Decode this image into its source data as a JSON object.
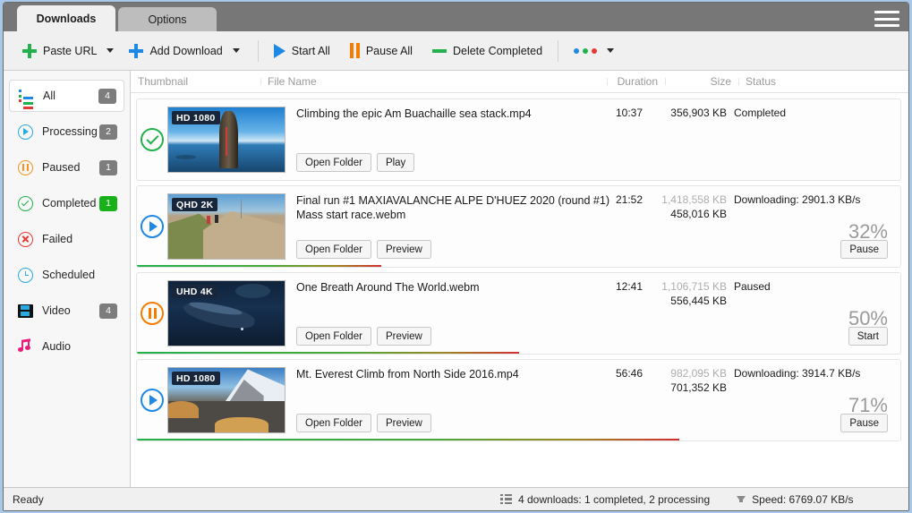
{
  "tabs": [
    {
      "label": "Downloads",
      "active": true
    },
    {
      "label": "Options",
      "active": false
    }
  ],
  "menu_icon": "hamburger-icon",
  "toolbar": {
    "paste_url": "Paste URL",
    "add_download": "Add Download",
    "start_all": "Start All",
    "pause_all": "Pause All",
    "delete_completed": "Delete Completed",
    "more_dots_colors": [
      "#1e88e5",
      "#22b14c",
      "#e53935"
    ]
  },
  "sidebar": {
    "items": [
      {
        "label": "All",
        "icon": "list-icon",
        "count": "4",
        "active": true,
        "badge_color": "#7d7d7d"
      },
      {
        "label": "Processing",
        "icon": "play-circle-icon",
        "count": "2",
        "active": false,
        "badge_color": "#7d7d7d"
      },
      {
        "label": "Paused",
        "icon": "pause-circle-icon",
        "count": "1",
        "active": false,
        "badge_color": "#7d7d7d"
      },
      {
        "label": "Completed",
        "icon": "check-circle-icon",
        "count": "1",
        "active": false,
        "badge_color": "#19b119"
      },
      {
        "label": "Failed",
        "icon": "error-circle-icon",
        "count": "",
        "active": false,
        "badge_color": ""
      },
      {
        "label": "Scheduled",
        "icon": "clock-icon",
        "count": "",
        "active": false,
        "badge_color": ""
      },
      {
        "label": "Video",
        "icon": "film-icon",
        "count": "4",
        "active": false,
        "badge_color": "#7d7d7d"
      },
      {
        "label": "Audio",
        "icon": "music-note-icon",
        "count": "",
        "active": false,
        "badge_color": ""
      }
    ]
  },
  "table": {
    "headers": {
      "thumbnail": "Thumbnail",
      "file_name": "File Name",
      "duration": "Duration",
      "size": "Size",
      "status": "Status"
    },
    "rows": [
      {
        "state_icon": "check-circle-icon",
        "state_color": "#22b14c",
        "quality_tag": "HD 1080",
        "file_name": "Climbing the epic Am Buachaille sea stack.mp4",
        "duration": "10:37",
        "size_total": "",
        "size_done": "356,903 KB",
        "status": "Completed",
        "percent": "",
        "progress": 100,
        "buttons": [
          "Open Folder",
          "Play"
        ],
        "action_button": "",
        "show_progress_bar": false
      },
      {
        "state_icon": "play-circle-icon",
        "state_color": "#1e88e5",
        "quality_tag": "QHD 2K",
        "file_name": "Final run #1  MAXIAVALANCHE ALPE D'HUEZ 2020 (round #1) Mass start race.webm",
        "duration": "21:52",
        "size_total": "1,418,558 KB",
        "size_done": "458,016 KB",
        "status": "Downloading: 2901.3 KB/s",
        "percent": "32%",
        "progress": 32,
        "buttons": [
          "Open Folder",
          "Preview"
        ],
        "action_button": "Pause",
        "show_progress_bar": true
      },
      {
        "state_icon": "pause-circle-icon",
        "state_color": "#f57c00",
        "quality_tag": "UHD 4K",
        "file_name": "One Breath Around The World.webm",
        "duration": "12:41",
        "size_total": "1,106,715 KB",
        "size_done": "556,445 KB",
        "status": "Paused",
        "percent": "50%",
        "progress": 50,
        "buttons": [
          "Open Folder",
          "Preview"
        ],
        "action_button": "Start",
        "show_progress_bar": true
      },
      {
        "state_icon": "play-circle-icon",
        "state_color": "#1e88e5",
        "quality_tag": "HD 1080",
        "file_name": "Mt. Everest Climb from North Side 2016.mp4",
        "duration": "56:46",
        "size_total": "982,095 KB",
        "size_done": "701,352 KB",
        "status": "Downloading: 3914.7 KB/s",
        "percent": "71%",
        "progress": 71,
        "buttons": [
          "Open Folder",
          "Preview"
        ],
        "action_button": "Pause",
        "show_progress_bar": true
      }
    ]
  },
  "statusbar": {
    "ready": "Ready",
    "downloads_summary": "4 downloads: 1 completed, 2 processing",
    "speed": "Speed: 6769.07 KB/s"
  }
}
